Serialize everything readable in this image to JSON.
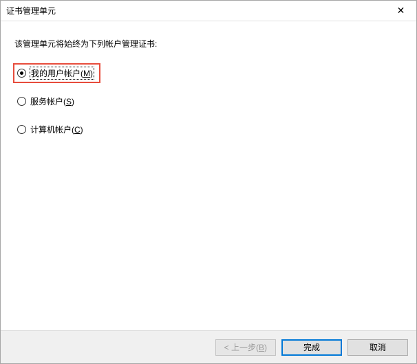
{
  "window": {
    "title": "证书管理单元"
  },
  "body": {
    "prompt": "该管理单元将始终为下列帐户管理证书:"
  },
  "options": {
    "myUser": {
      "label_pre": "我的用户帐户(",
      "hotkey": "M",
      "label_post": ")",
      "selected": true,
      "highlighted": true
    },
    "service": {
      "label_pre": "服务帐户(",
      "hotkey": "S",
      "label_post": ")",
      "selected": false,
      "highlighted": false
    },
    "computer": {
      "label_pre": "计算机帐户(",
      "hotkey": "C",
      "label_post": ")",
      "selected": false,
      "highlighted": false
    }
  },
  "buttons": {
    "back": {
      "label_pre": "< 上一步(",
      "hotkey": "B",
      "label_post": ")",
      "enabled": false
    },
    "finish": {
      "label": "完成",
      "default": true
    },
    "cancel": {
      "label": "取消"
    }
  }
}
